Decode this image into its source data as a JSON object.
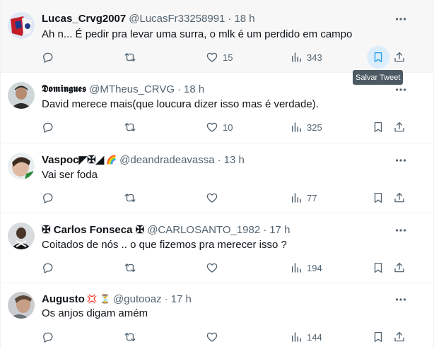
{
  "tweets": [
    {
      "name": "Lucas_Crvg2007",
      "handle": "@LucasFr33258991",
      "time": "18 h",
      "text": "Ah n... É pedir pra levar uma surra, o mlk é um perdido em campo",
      "likes": "15",
      "views": "343",
      "avatar_color": "#c0d4ec"
    },
    {
      "name": "𝕯𝖔𝖒𝖎𝖓𝖌𝖚𝖊𝖘",
      "handle": "@MTheus_CRVG",
      "time": "18 h",
      "text": "David merece mais(que loucura dizer isso mas é verdade).",
      "likes": "10",
      "views": "325",
      "avatar_color": "#6e7a7c"
    },
    {
      "name": "Vaspoc◤✠◢",
      "badge": "🌈",
      "handle": "@deandradeavassa",
      "time": "13 h",
      "text": "Vai ser foda",
      "likes": "",
      "views": "77",
      "avatar_color": "#d9b8a6"
    },
    {
      "name": "✠ Carlos Fonseca ✠",
      "handle": "@CARLOSANTO_1982",
      "time": "17 h",
      "text": "Coitados de nós .. o que fizemos pra merecer isso ?",
      "likes": "",
      "views": "194",
      "avatar_color": "#3a3532"
    },
    {
      "name": "Augusto",
      "badge": "💢 ⏳",
      "handle": "@gutooaz",
      "time": "17 h",
      "text": "Os anjos digam amém",
      "likes": "",
      "views": "144",
      "avatar_color": "#9ba1a6"
    }
  ],
  "tooltip": "Salvar Tweet",
  "colors": {
    "text": "#0f1419",
    "secondary": "#536471",
    "hover_bg": "#f7f7f7",
    "bookmark_hover": "#dceefb",
    "accent": "#1d9bf0"
  }
}
